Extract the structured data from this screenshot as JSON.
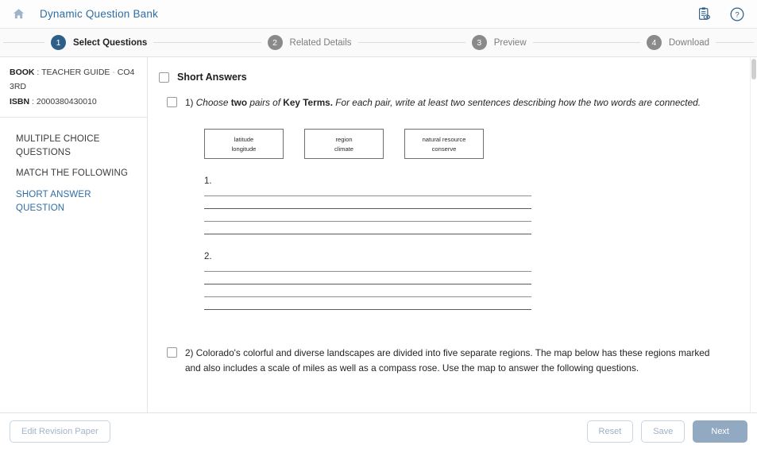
{
  "topbar": {
    "home_icon": "home-icon",
    "title": "Dynamic Question Bank",
    "review_icon": "clipboard-eye-icon",
    "help_icon": "help-circle-icon"
  },
  "stepper": {
    "steps": [
      {
        "number": "1",
        "label": "Select Questions",
        "active": true
      },
      {
        "number": "2",
        "label": "Related Details",
        "active": false
      },
      {
        "number": "3",
        "label": "Preview",
        "active": false
      },
      {
        "number": "4",
        "label": "Download",
        "active": false
      }
    ]
  },
  "sidebar": {
    "book_key": "BOOK",
    "book_sep": ":",
    "book_value": "TEACHER GUIDE",
    "book_dash": "-",
    "book_code": "CO4 3RD",
    "isbn_key": "ISBN",
    "isbn_sep": ":",
    "isbn_value": "2000380430010",
    "items": [
      {
        "label": "MULTIPLE CHOICE QUESTIONS",
        "selected": false
      },
      {
        "label": "MATCH THE FOLLOWING",
        "selected": false
      },
      {
        "label": "SHORT ANSWER QUESTION",
        "selected": true
      }
    ]
  },
  "content": {
    "section_title": "Short Answers",
    "q1": {
      "number": "1)",
      "part1": "Choose ",
      "part2": "two",
      "part3": " pairs of ",
      "part4": "Key Terms.",
      "part5": " For each pair, write at least two sentences describing how the two words are connected.",
      "term_boxes": [
        {
          "line1": "latitude",
          "line2": "longitude"
        },
        {
          "line1": "region",
          "line2": "climate"
        },
        {
          "line1": "natural resource",
          "line2": "conserve"
        }
      ],
      "answers": [
        {
          "label": "1.",
          "line_count": 4
        },
        {
          "label": "2.",
          "line_count": 4
        }
      ]
    },
    "q2": {
      "number": "2)",
      "text": "Colorado's colorful and diverse landscapes are divided into five separate regions. The map below has these regions marked and also includes a scale of miles as well as a compass rose. Use the map to answer the following questions."
    }
  },
  "footer": {
    "edit_label": "Edit Revision Paper",
    "reset_label": "Reset",
    "save_label": "Save",
    "next_label": "Next"
  },
  "colors": {
    "brand_blue": "#2f6ea5",
    "step_active": "#2e5f88",
    "step_inactive": "#8a8a8a",
    "primary_button": "#91a9c1",
    "home_icon": "#9db4cb"
  }
}
